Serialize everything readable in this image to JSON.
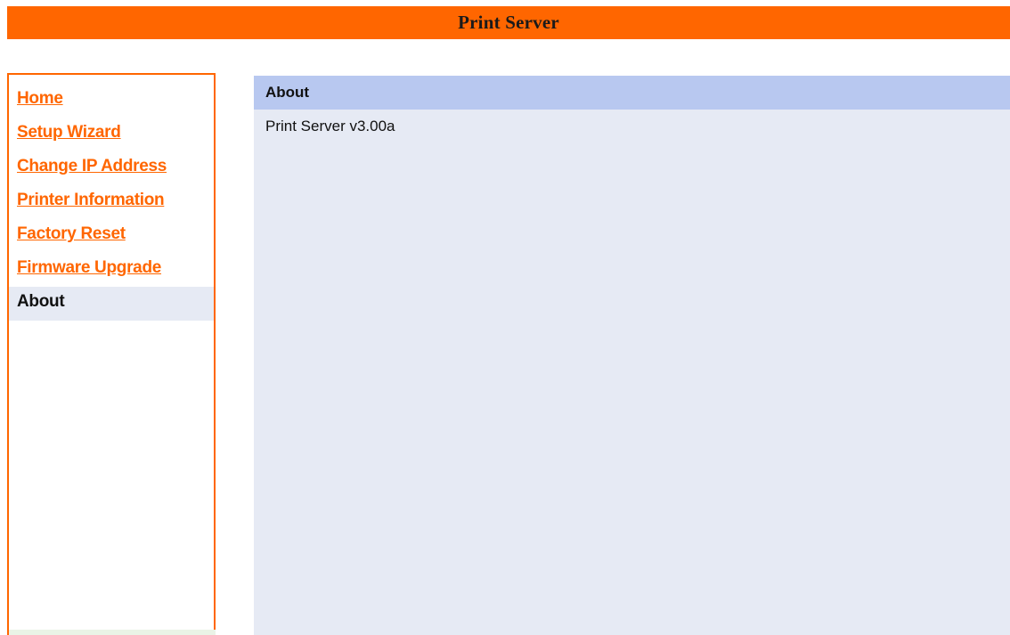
{
  "header": {
    "title": "Print Server"
  },
  "sidebar": {
    "items": [
      {
        "label": "Home",
        "active": false
      },
      {
        "label": "Setup Wizard",
        "active": false
      },
      {
        "label": "Change IP Address",
        "active": false
      },
      {
        "label": "Printer Information",
        "active": false
      },
      {
        "label": "Factory Reset",
        "active": false
      },
      {
        "label": "Firmware Upgrade",
        "active": false
      },
      {
        "label": "About",
        "active": true
      }
    ]
  },
  "main": {
    "section_title": "About",
    "version_text": "Print Server v3.00a"
  },
  "colors": {
    "accent": "#ff6600",
    "section_header": "#b8c8f0",
    "content_bg": "#e6eaf4"
  }
}
